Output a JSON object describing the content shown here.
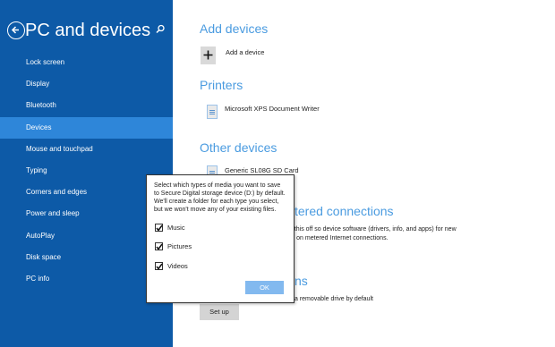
{
  "sidebar": {
    "title": "PC and devices",
    "items": [
      {
        "label": "Lock screen"
      },
      {
        "label": "Display"
      },
      {
        "label": "Bluetooth"
      },
      {
        "label": "Devices"
      },
      {
        "label": "Mouse and touchpad"
      },
      {
        "label": "Typing"
      },
      {
        "label": "Corners and edges"
      },
      {
        "label": "Power and sleep"
      },
      {
        "label": "AutoPlay"
      },
      {
        "label": "Disk space"
      },
      {
        "label": "PC info"
      }
    ],
    "selected": "Devices"
  },
  "main": {
    "add_devices": {
      "title": "Add devices",
      "add_label": "Add a device"
    },
    "printers": {
      "title": "Printers",
      "items": [
        "Microsoft XPS Document Writer"
      ]
    },
    "other_devices": {
      "title": "Other devices",
      "items": [
        "Generic SL08G SD Card"
      ]
    },
    "metered": {
      "title_partial": "tered connections",
      "line1": "o this off so device software (drivers, info, and apps) for new",
      "line2": "re on metered Internet connections."
    },
    "default_save": {
      "title_partial": "ns",
      "line1": "a removable drive by default",
      "setup_label": "Set up"
    }
  },
  "dialog": {
    "lines": [
      "Select which types of media you want to save",
      "to Secure Digital storage device (D:) by default.",
      "We'll create a folder for each type you select,",
      "but we won't move any of your existing files."
    ],
    "options": [
      {
        "label": "Music",
        "checked": true
      },
      {
        "label": "Pictures",
        "checked": true
      },
      {
        "label": "Videos",
        "checked": true
      }
    ],
    "ok_label": "OK"
  },
  "colors": {
    "sidebar_bg": "#0d5aa7",
    "sidebar_selected": "#2e86d9",
    "section_title": "#4a9be0",
    "ok_button": "#82b9ef"
  }
}
